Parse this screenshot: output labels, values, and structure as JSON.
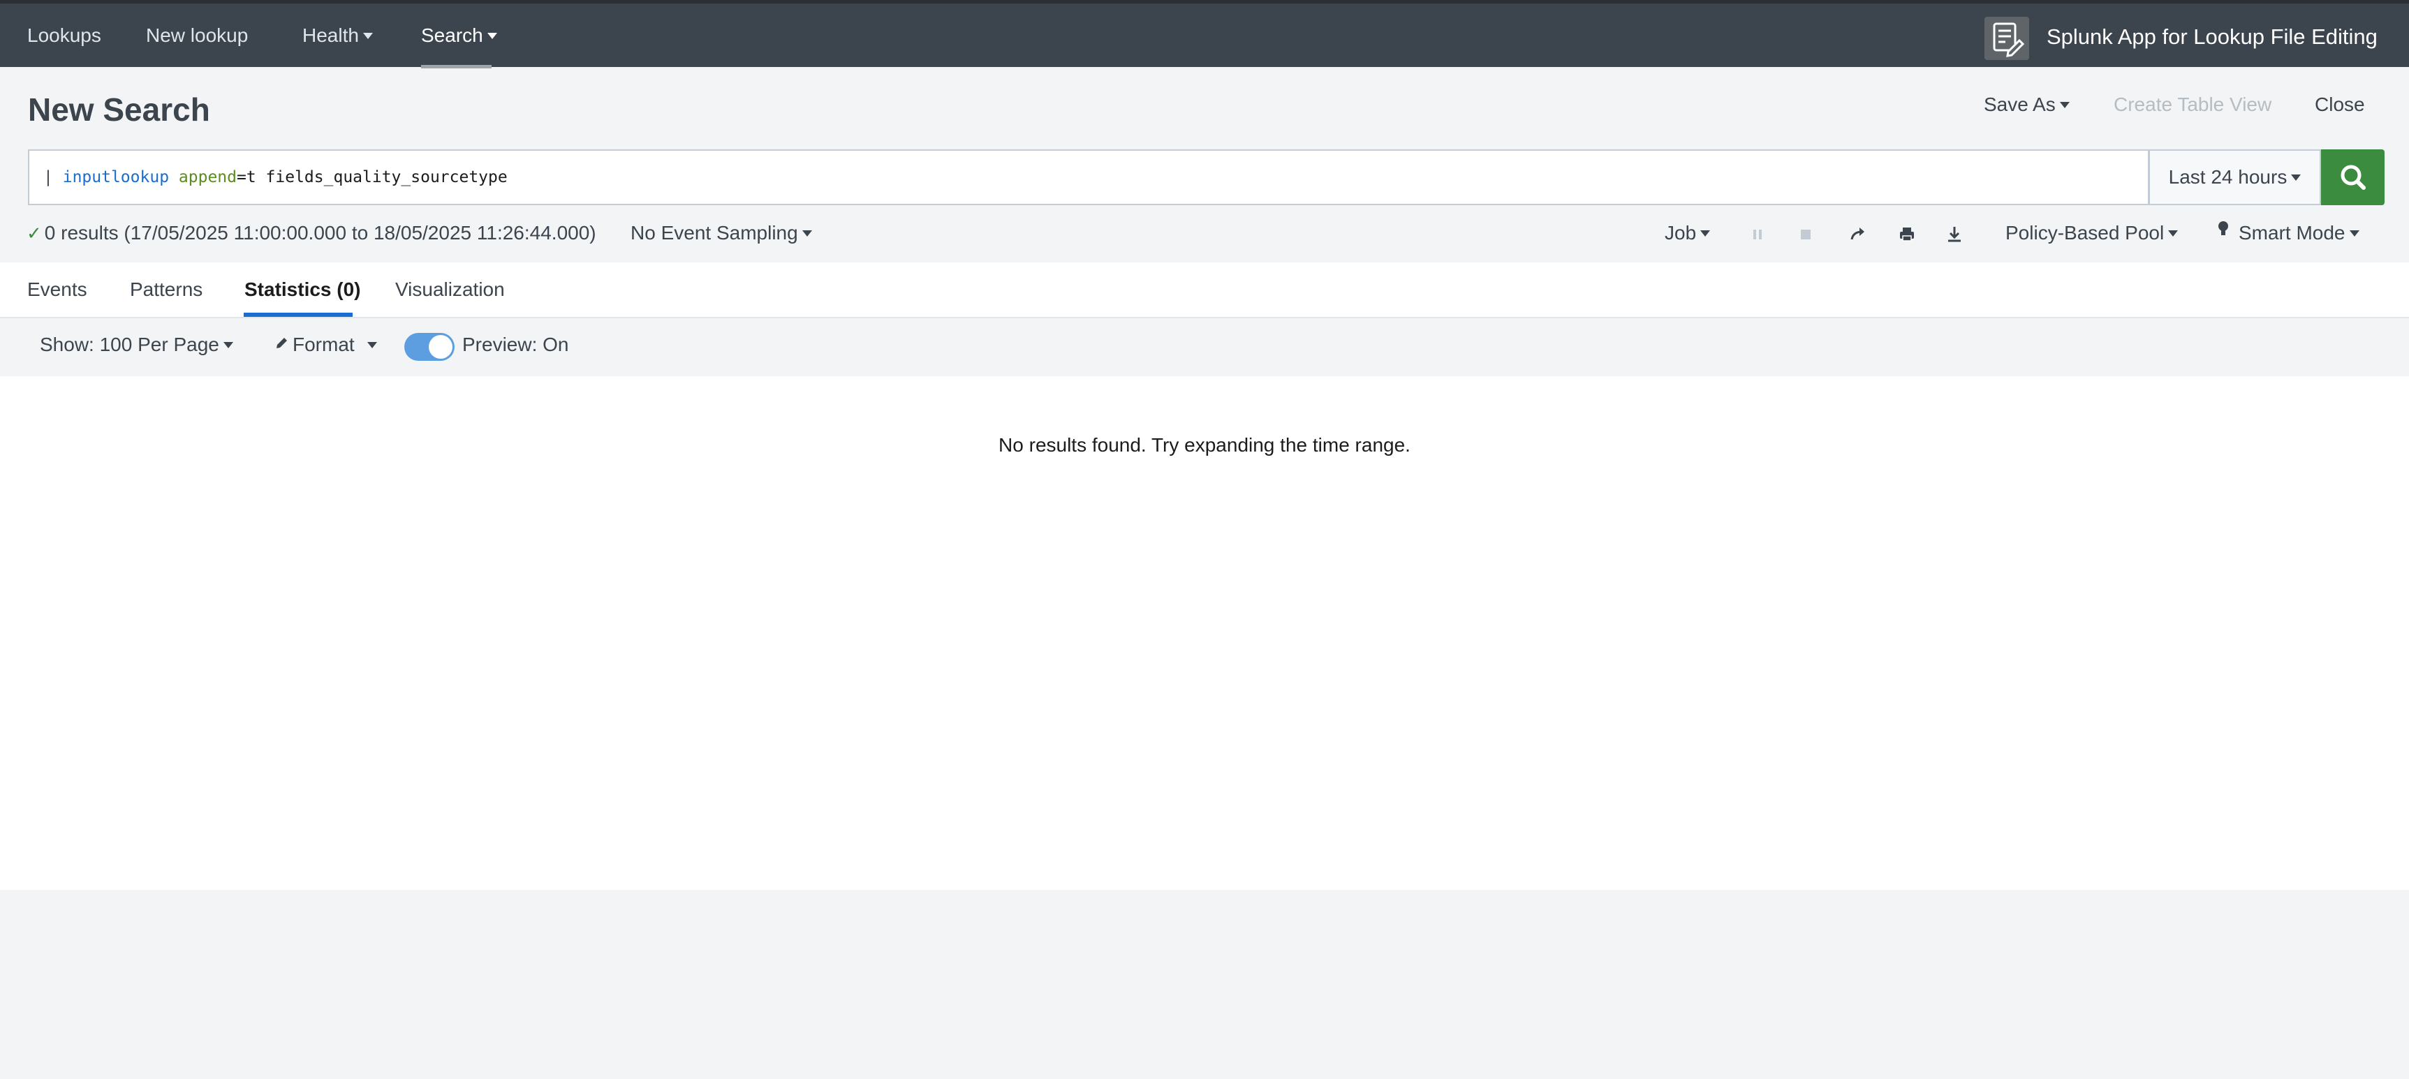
{
  "topnav": {
    "items": [
      {
        "label": "Lookups",
        "has_menu": false,
        "active": false
      },
      {
        "label": "New lookup",
        "has_menu": false,
        "active": false
      },
      {
        "label": "Health",
        "has_menu": true,
        "active": false
      },
      {
        "label": "Search",
        "has_menu": true,
        "active": true
      }
    ],
    "app_title": "Splunk App for Lookup File Editing",
    "app_icon": "lookup-editor-icon"
  },
  "header": {
    "title": "New Search",
    "save_as": "Save As",
    "create_table_view": "Create Table View",
    "close": "Close"
  },
  "search": {
    "pipe": "|",
    "command": "inputlookup",
    "arg_key": "append",
    "arg_rest": "=t fields_quality_sourcetype",
    "time_range": "Last 24 hours",
    "search_icon": "magnifier-icon"
  },
  "status": {
    "summary": "0 results (17/05/2025 11:00:00.000 to 18/05/2025 11:26:44.000)",
    "sampling": "No Event Sampling",
    "job": "Job",
    "pool": "Policy-Based Pool",
    "mode": "Smart Mode",
    "icons": [
      "pause-icon",
      "stop-icon",
      "share-icon",
      "print-icon",
      "export-icon",
      "lightbulb-icon"
    ]
  },
  "tabs": [
    {
      "label": "Events",
      "active": false
    },
    {
      "label": "Patterns",
      "active": false
    },
    {
      "label": "Statistics (0)",
      "active": true
    },
    {
      "label": "Visualization",
      "active": false
    }
  ],
  "results_toolbar": {
    "per_page": "Show: 100 Per Page",
    "format": "Format",
    "preview": "Preview: On",
    "preview_on": true
  },
  "results": {
    "empty_message": "No results found. Try expanding the time range."
  },
  "colors": {
    "topbar": "#3c444d",
    "accent_blue": "#1a6dd0",
    "search_green": "#3c8c40",
    "toggle_blue": "#5c9ee0"
  }
}
